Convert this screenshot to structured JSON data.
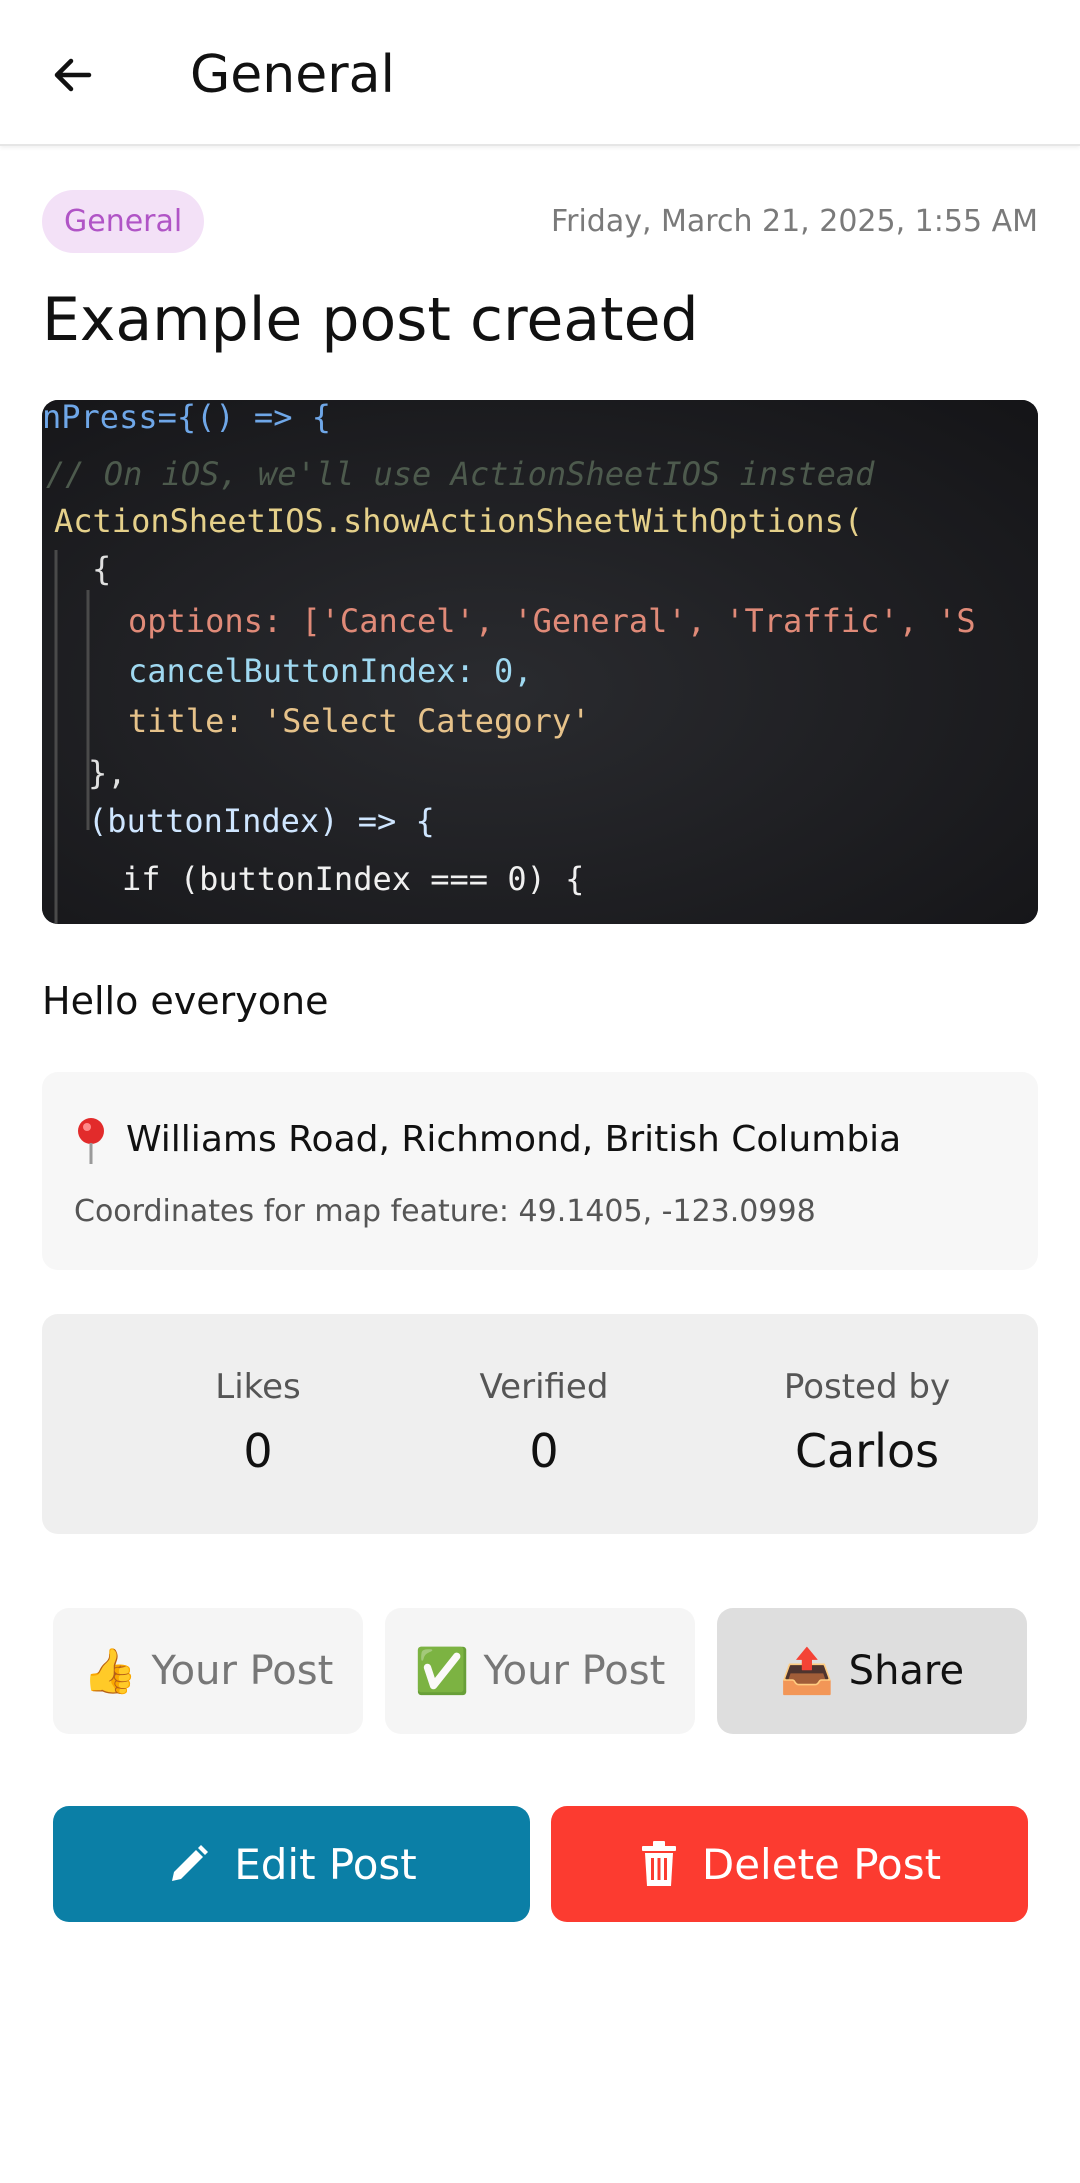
{
  "header": {
    "title": "General",
    "back_icon": "arrow-left-icon"
  },
  "post": {
    "category": "General",
    "timestamp": "Friday, March 21, 2025, 1:55 AM",
    "title": "Example post created",
    "body": "Hello everyone",
    "image": {
      "code_lines": [
        "nPress={() => {",
        "// On iOS, we'll use ActionSheetIOS instead",
        "ActionSheetIOS.showActionSheetWithOptions(",
        "{",
        "options: ['Cancel', 'General', 'Traffic', 'S",
        "cancelButtonIndex: 0,",
        "title: 'Select Category'",
        "},",
        "(buttonIndex) => {",
        "if (buttonIndex === 0) {"
      ]
    }
  },
  "location": {
    "icon": "pin-icon",
    "name": "Williams Road, Richmond, British Columbia",
    "coords_label": "Coordinates for map feature: 49.1405, -123.0998"
  },
  "stats": {
    "likes_label": "Likes",
    "likes_value": "0",
    "verified_label": "Verified",
    "verified_value": "0",
    "posted_label": "Posted by",
    "posted_value": "Carlos"
  },
  "actions": {
    "like_emoji": "👍",
    "like_label": "Your Post",
    "verify_emoji": "✅",
    "verify_label": "Your Post",
    "share_emoji": "📤",
    "share_label": "Share"
  },
  "buttons": {
    "edit_label": "Edit Post",
    "delete_label": "Delete Post"
  },
  "colors": {
    "badge_bg": "#f3e1f7",
    "badge_text": "#b054c6",
    "edit": "#0b7fa6",
    "delete": "#fc3b30"
  }
}
